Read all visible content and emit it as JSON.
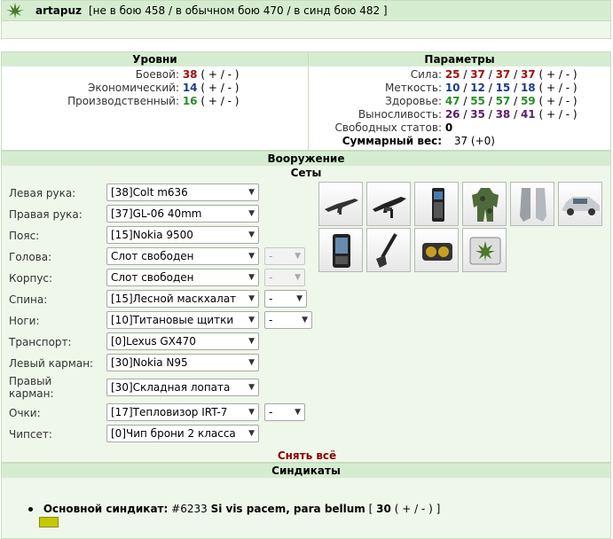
{
  "header": {
    "username": "artapuz",
    "battle_info": "[не в бою 458 / в обычном бою 470 / в синд бою 482 ]"
  },
  "levels": {
    "title": "Уровни",
    "items": [
      {
        "label": "Боевой:",
        "value": "38",
        "controls": "( + / - )",
        "color": "#a01010"
      },
      {
        "label": "Экономический:",
        "value": "14",
        "controls": "( + / - )",
        "color": "#1c3c8c"
      },
      {
        "label": "Производственный:",
        "value": "16",
        "controls": "( + / - )",
        "color": "#2a8c2a"
      }
    ]
  },
  "params": {
    "title": "Параметры",
    "items": [
      {
        "label": "Сила:",
        "values": [
          "25",
          "37",
          "37",
          "37"
        ],
        "controls": "( + / - )",
        "color": "#a01010"
      },
      {
        "label": "Меткость:",
        "values": [
          "10",
          "12",
          "15",
          "18"
        ],
        "controls": "( + / - )",
        "color": "#1c3c8c"
      },
      {
        "label": "Здоровье:",
        "values": [
          "47",
          "55",
          "57",
          "59"
        ],
        "controls": "( + / - )",
        "color": "#2a8c2a"
      },
      {
        "label": "Выносливость:",
        "values": [
          "26",
          "35",
          "38",
          "41"
        ],
        "controls": "( + / - )",
        "color": "#5c1c6c"
      }
    ],
    "free_stats_label": "Свободных статов:",
    "free_stats_value": "0",
    "total_weight_label": "Суммарный вес:",
    "total_weight_value": "37 (+0)"
  },
  "weapons": {
    "title": "Вооружение",
    "sets_title": "Сеты",
    "slots": [
      {
        "label": "Левая рука:",
        "value": "[38]Colt m636"
      },
      {
        "label": "Правая рука:",
        "value": "[37]GL-06 40mm"
      },
      {
        "label": "Пояс:",
        "value": "[15]Nokia 9500"
      },
      {
        "label": "Голова:",
        "value": "Слот свободен",
        "extra": "-",
        "extra_disabled": true
      },
      {
        "label": "Корпус:",
        "value": "Слот свободен",
        "extra": "-",
        "extra_disabled": true
      },
      {
        "label": "Спина:",
        "value": "[15]Лесной маскхалат",
        "extra": "-"
      },
      {
        "label": "Ноги:",
        "value": "[10]Титановые щитки",
        "extra": "-"
      },
      {
        "label": "Транспорт:",
        "value": "[0]Lexus GX470"
      },
      {
        "label": "Левый карман:",
        "value": "[30]Nokia N95"
      },
      {
        "label": "Правый карман:",
        "value": "[30]Складная лопата"
      },
      {
        "label": "Очки:",
        "value": "[17]Тепловизор IRT-7",
        "extra": "-"
      },
      {
        "label": "Чипсет:",
        "value": "[0]Чип брони 2 класса"
      }
    ],
    "remove_all": "Снять всё",
    "item_icons": [
      "rifle-icon",
      "grenade-launcher-icon",
      "phone-icon",
      "camo-suit-icon",
      "leg-armor-icon",
      "suv-icon",
      "smartphone-icon",
      "shovel-icon",
      "thermal-goggles-icon",
      "chip-icon"
    ]
  },
  "syndicates": {
    "title": "Синдикаты",
    "main_label": "Основной синдикат:",
    "id": "#6233",
    "name": "Si vis pacem, para bellum",
    "level_open": "[",
    "level": "30",
    "controls": "( + / - )",
    "level_close": "]"
  }
}
